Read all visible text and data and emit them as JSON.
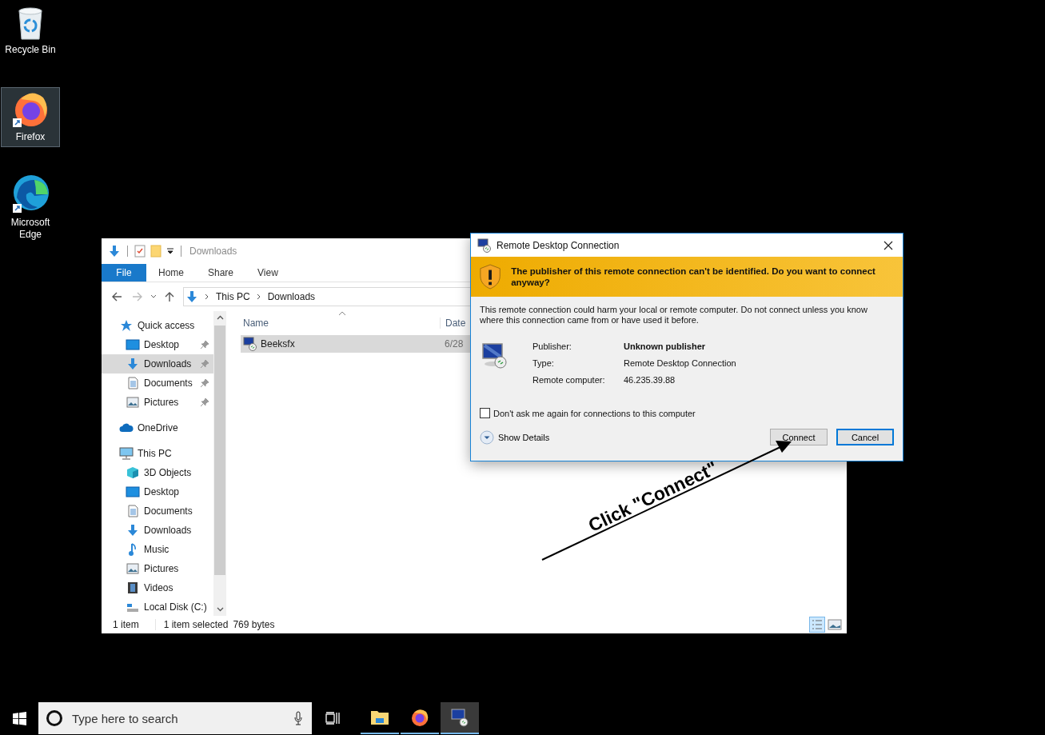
{
  "desktop_icons": [
    {
      "label": "Recycle Bin",
      "kind": "recycle",
      "selected": false
    },
    {
      "label": "Firefox",
      "kind": "firefox",
      "selected": true
    },
    {
      "label": "Microsoft Edge",
      "kind": "edge",
      "selected": false
    }
  ],
  "explorer": {
    "title": "Downloads",
    "ribbon_tabs": [
      {
        "label": "File",
        "kind": "file"
      },
      {
        "label": "Home",
        "kind": "tab"
      },
      {
        "label": "Share",
        "kind": "tab"
      },
      {
        "label": "View",
        "kind": "tab"
      }
    ],
    "breadcrumb": [
      "This PC",
      "Downloads"
    ],
    "nav": [
      {
        "label": "Quick access",
        "kind": "star",
        "selected": false,
        "children": [
          {
            "label": "Desktop",
            "kind": "desktop",
            "selected": false,
            "pinned": true
          },
          {
            "label": "Downloads",
            "kind": "download",
            "selected": true,
            "pinned": true
          },
          {
            "label": "Documents",
            "kind": "document",
            "selected": false,
            "pinned": true
          },
          {
            "label": "Pictures",
            "kind": "picture",
            "selected": false,
            "pinned": true
          }
        ]
      },
      {
        "label": "OneDrive",
        "kind": "cloud",
        "selected": false
      },
      {
        "label": "This PC",
        "kind": "pc",
        "selected": false,
        "children": [
          {
            "label": "3D Objects",
            "kind": "cube",
            "selected": false,
            "pinned": false
          },
          {
            "label": "Desktop",
            "kind": "desktop",
            "selected": false,
            "pinned": false
          },
          {
            "label": "Documents",
            "kind": "document",
            "selected": false,
            "pinned": false
          },
          {
            "label": "Downloads",
            "kind": "download",
            "selected": false,
            "pinned": false
          },
          {
            "label": "Music",
            "kind": "music",
            "selected": false,
            "pinned": false
          },
          {
            "label": "Pictures",
            "kind": "picture",
            "selected": false,
            "pinned": false
          },
          {
            "label": "Videos",
            "kind": "video",
            "selected": false,
            "pinned": false
          },
          {
            "label": "Local Disk (C:)",
            "kind": "disk",
            "selected": false,
            "pinned": false
          }
        ]
      }
    ],
    "columns": [
      "Name",
      "Date"
    ],
    "rows": [
      {
        "name": "Beeksfx",
        "date": "6/28",
        "selected": true
      }
    ],
    "status": {
      "count": "1 item",
      "selection": "1 item selected",
      "size": "769 bytes"
    }
  },
  "dialog": {
    "title": "Remote Desktop Connection",
    "warning": "The publisher of this remote connection can't be identified. Do you want to connect anyway?",
    "message": "This remote connection could harm your local or remote computer. Do not connect unless you know where this connection came from or have used it before.",
    "details": [
      {
        "label": "Publisher:",
        "value": "Unknown publisher",
        "bold": true
      },
      {
        "label": "Type:",
        "value": "Remote Desktop Connection",
        "bold": false
      },
      {
        "label": "Remote computer:",
        "value": "46.235.39.88",
        "bold": false
      }
    ],
    "checkbox": {
      "label": "Don't ask me again for connections to this computer",
      "checked": false
    },
    "show_details": "Show Details",
    "buttons": [
      {
        "label": "Connect",
        "default": false
      },
      {
        "label": "Cancel",
        "default": true
      }
    ]
  },
  "annotation": {
    "text": "Click \"Connect\""
  },
  "taskbar": {
    "search": {
      "placeholder": "Type here to search"
    },
    "apps": [
      {
        "kind": "explorer",
        "running": true,
        "active": false
      },
      {
        "kind": "firefox",
        "running": true,
        "active": false
      },
      {
        "kind": "rdp",
        "running": true,
        "active": true
      }
    ]
  }
}
